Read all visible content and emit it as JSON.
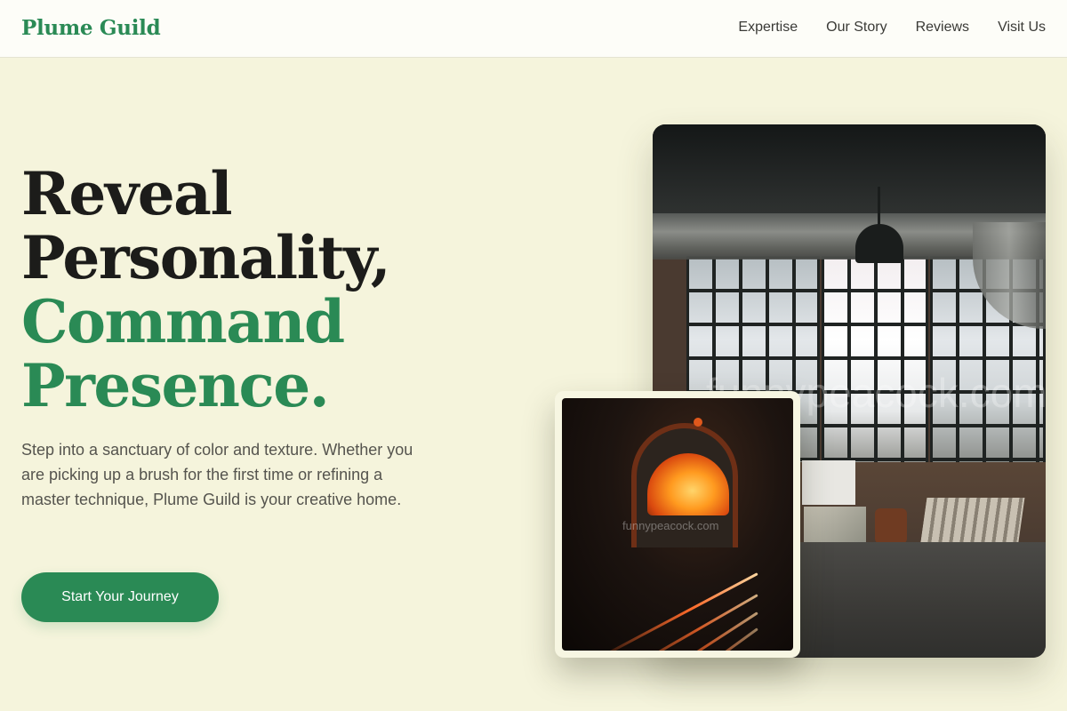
{
  "header": {
    "brand": "Plume Guild",
    "nav": [
      "Expertise",
      "Our Story",
      "Reviews",
      "Visit Us"
    ]
  },
  "hero": {
    "title_line1": "Reveal",
    "title_line2": "Personality,",
    "title_line3": "Command",
    "title_line4": "Presence.",
    "description": "Step into a sanctuary of color and texture. Whether you are picking up a brush for the first time or refining a master technique, Plume Guild is your creative home.",
    "cta_label": "Start Your Journey"
  },
  "images": {
    "main_watermark": "funnypeacock.com",
    "small_watermark": "funnypeacock.com"
  },
  "colors": {
    "background": "#f5f4dc",
    "accent_green": "#2a8a55",
    "text_dark": "#1c1c1a"
  }
}
